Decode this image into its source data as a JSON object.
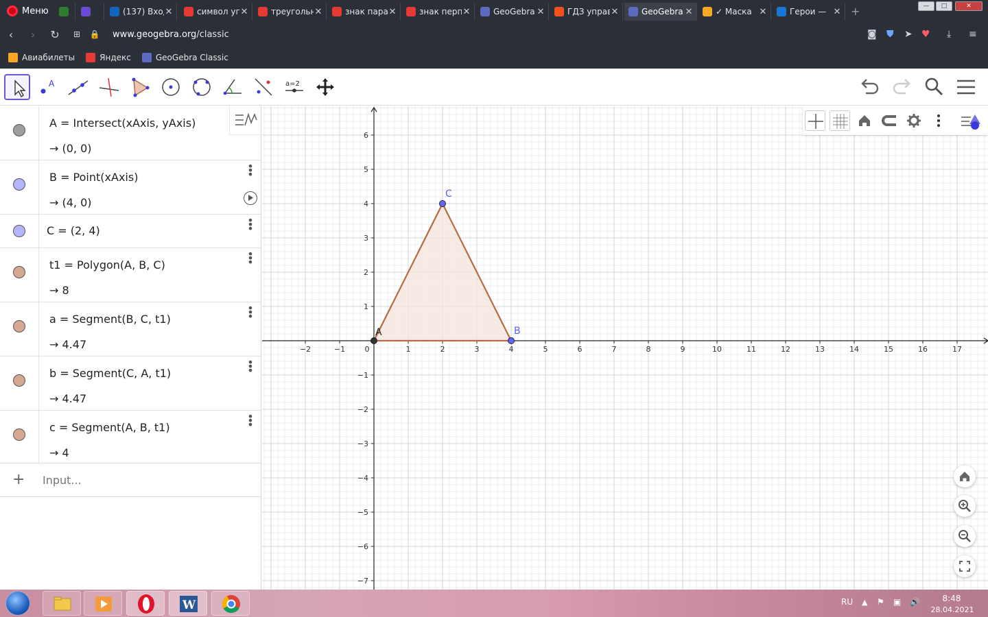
{
  "browser": {
    "menu_label": "Меню",
    "tabs": [
      {
        "title": "",
        "icon": "app-icon",
        "color": "#2e7d32"
      },
      {
        "title": "",
        "icon": "apps-icon",
        "color": "#6b4bd1"
      },
      {
        "title": "(137) Вход",
        "icon": "mail-icon",
        "color": "#1565c0"
      },
      {
        "title": "символ уг",
        "icon": "yandex-icon",
        "color": "#e53935"
      },
      {
        "title": "треугольн",
        "icon": "yandex-icon",
        "color": "#e53935"
      },
      {
        "title": "знак пара",
        "icon": "yandex-icon",
        "color": "#e53935"
      },
      {
        "title": "знак перп",
        "icon": "yandex-icon",
        "color": "#e53935"
      },
      {
        "title": "GeoGebra",
        "icon": "geogebra-icon",
        "color": "#5c6bc0"
      },
      {
        "title": "ГДЗ управ",
        "icon": "gdz-icon",
        "color": "#f4511e"
      },
      {
        "title": "GeoGebra",
        "icon": "geogebra-icon",
        "color": "#5c6bc0"
      },
      {
        "title": "✓ Маска",
        "icon": "music-icon",
        "color": "#f9a825"
      },
      {
        "title": "Герои —",
        "icon": "doc-icon",
        "color": "#1976d2"
      }
    ],
    "url_domain": "www.geogebra.org",
    "url_path": "/classic",
    "bookmarks": [
      {
        "label": "Авиабилеты",
        "color": "#f9a825"
      },
      {
        "label": "Яндекс",
        "color": "#e53935"
      },
      {
        "label": "GeoGebra Classic",
        "color": "#5c6bc0"
      }
    ]
  },
  "toolbar": {
    "tools": [
      "move-tool",
      "point-tool",
      "line-tool",
      "perpendicular-tool",
      "polygon-tool",
      "circle-tool",
      "circle-three-points-tool",
      "angle-tool",
      "reflect-tool",
      "slider-tool",
      "move-view-tool"
    ],
    "slider_label": "a=2",
    "point_label": "A",
    "accent": "#6557d2"
  },
  "algebra": {
    "rows": [
      {
        "def": "A  =  Intersect(xAxis, yAxis)",
        "val": "→   (0,  0)",
        "color": "#9e9e9e"
      },
      {
        "def": "B  =  Point(xAxis)",
        "val": "→   (4,  0)",
        "color": "#b4b4ff"
      },
      {
        "def": "C  =  (2,  4)",
        "val": "",
        "color": "#b4b4ff"
      },
      {
        "def": "t1  =  Polygon(A, B, C)",
        "val": "→   8",
        "color": "#d4a98f"
      },
      {
        "def": "a  =  Segment(B, C, t1)",
        "val": "→   4.47",
        "color": "#d4a98f"
      },
      {
        "def": "b  =  Segment(C, A, t1)",
        "val": "→   4.47",
        "color": "#d4a98f"
      },
      {
        "def": "c  =  Segment(A, B, t1)",
        "val": "→   4",
        "color": "#d4a98f"
      }
    ],
    "input_placeholder": "Input..."
  },
  "graphics": {
    "x_ticks": [
      "−2",
      "−1",
      "0",
      "1",
      "2",
      "3",
      "4",
      "5",
      "6",
      "7",
      "8",
      "9",
      "10",
      "11",
      "12",
      "13",
      "14",
      "15",
      "16",
      "17"
    ],
    "y_ticks": [
      "6",
      "5",
      "4",
      "3",
      "2",
      "1",
      "−1",
      "−2",
      "−3",
      "−4",
      "−5",
      "−6",
      "−7"
    ],
    "points": [
      {
        "name": "A",
        "x": 0,
        "y": 0,
        "color": "#222222"
      },
      {
        "name": "B",
        "x": 4,
        "y": 0,
        "color": "#5c5cff"
      },
      {
        "name": "C",
        "x": 2,
        "y": 4,
        "color": "#5c5cff"
      }
    ],
    "polygon_color": "#b56a45",
    "polygon_fill": "#f3e4dc"
  },
  "taskbar": {
    "lang": "RU",
    "time": "8:48",
    "date": "28.04.2021"
  }
}
